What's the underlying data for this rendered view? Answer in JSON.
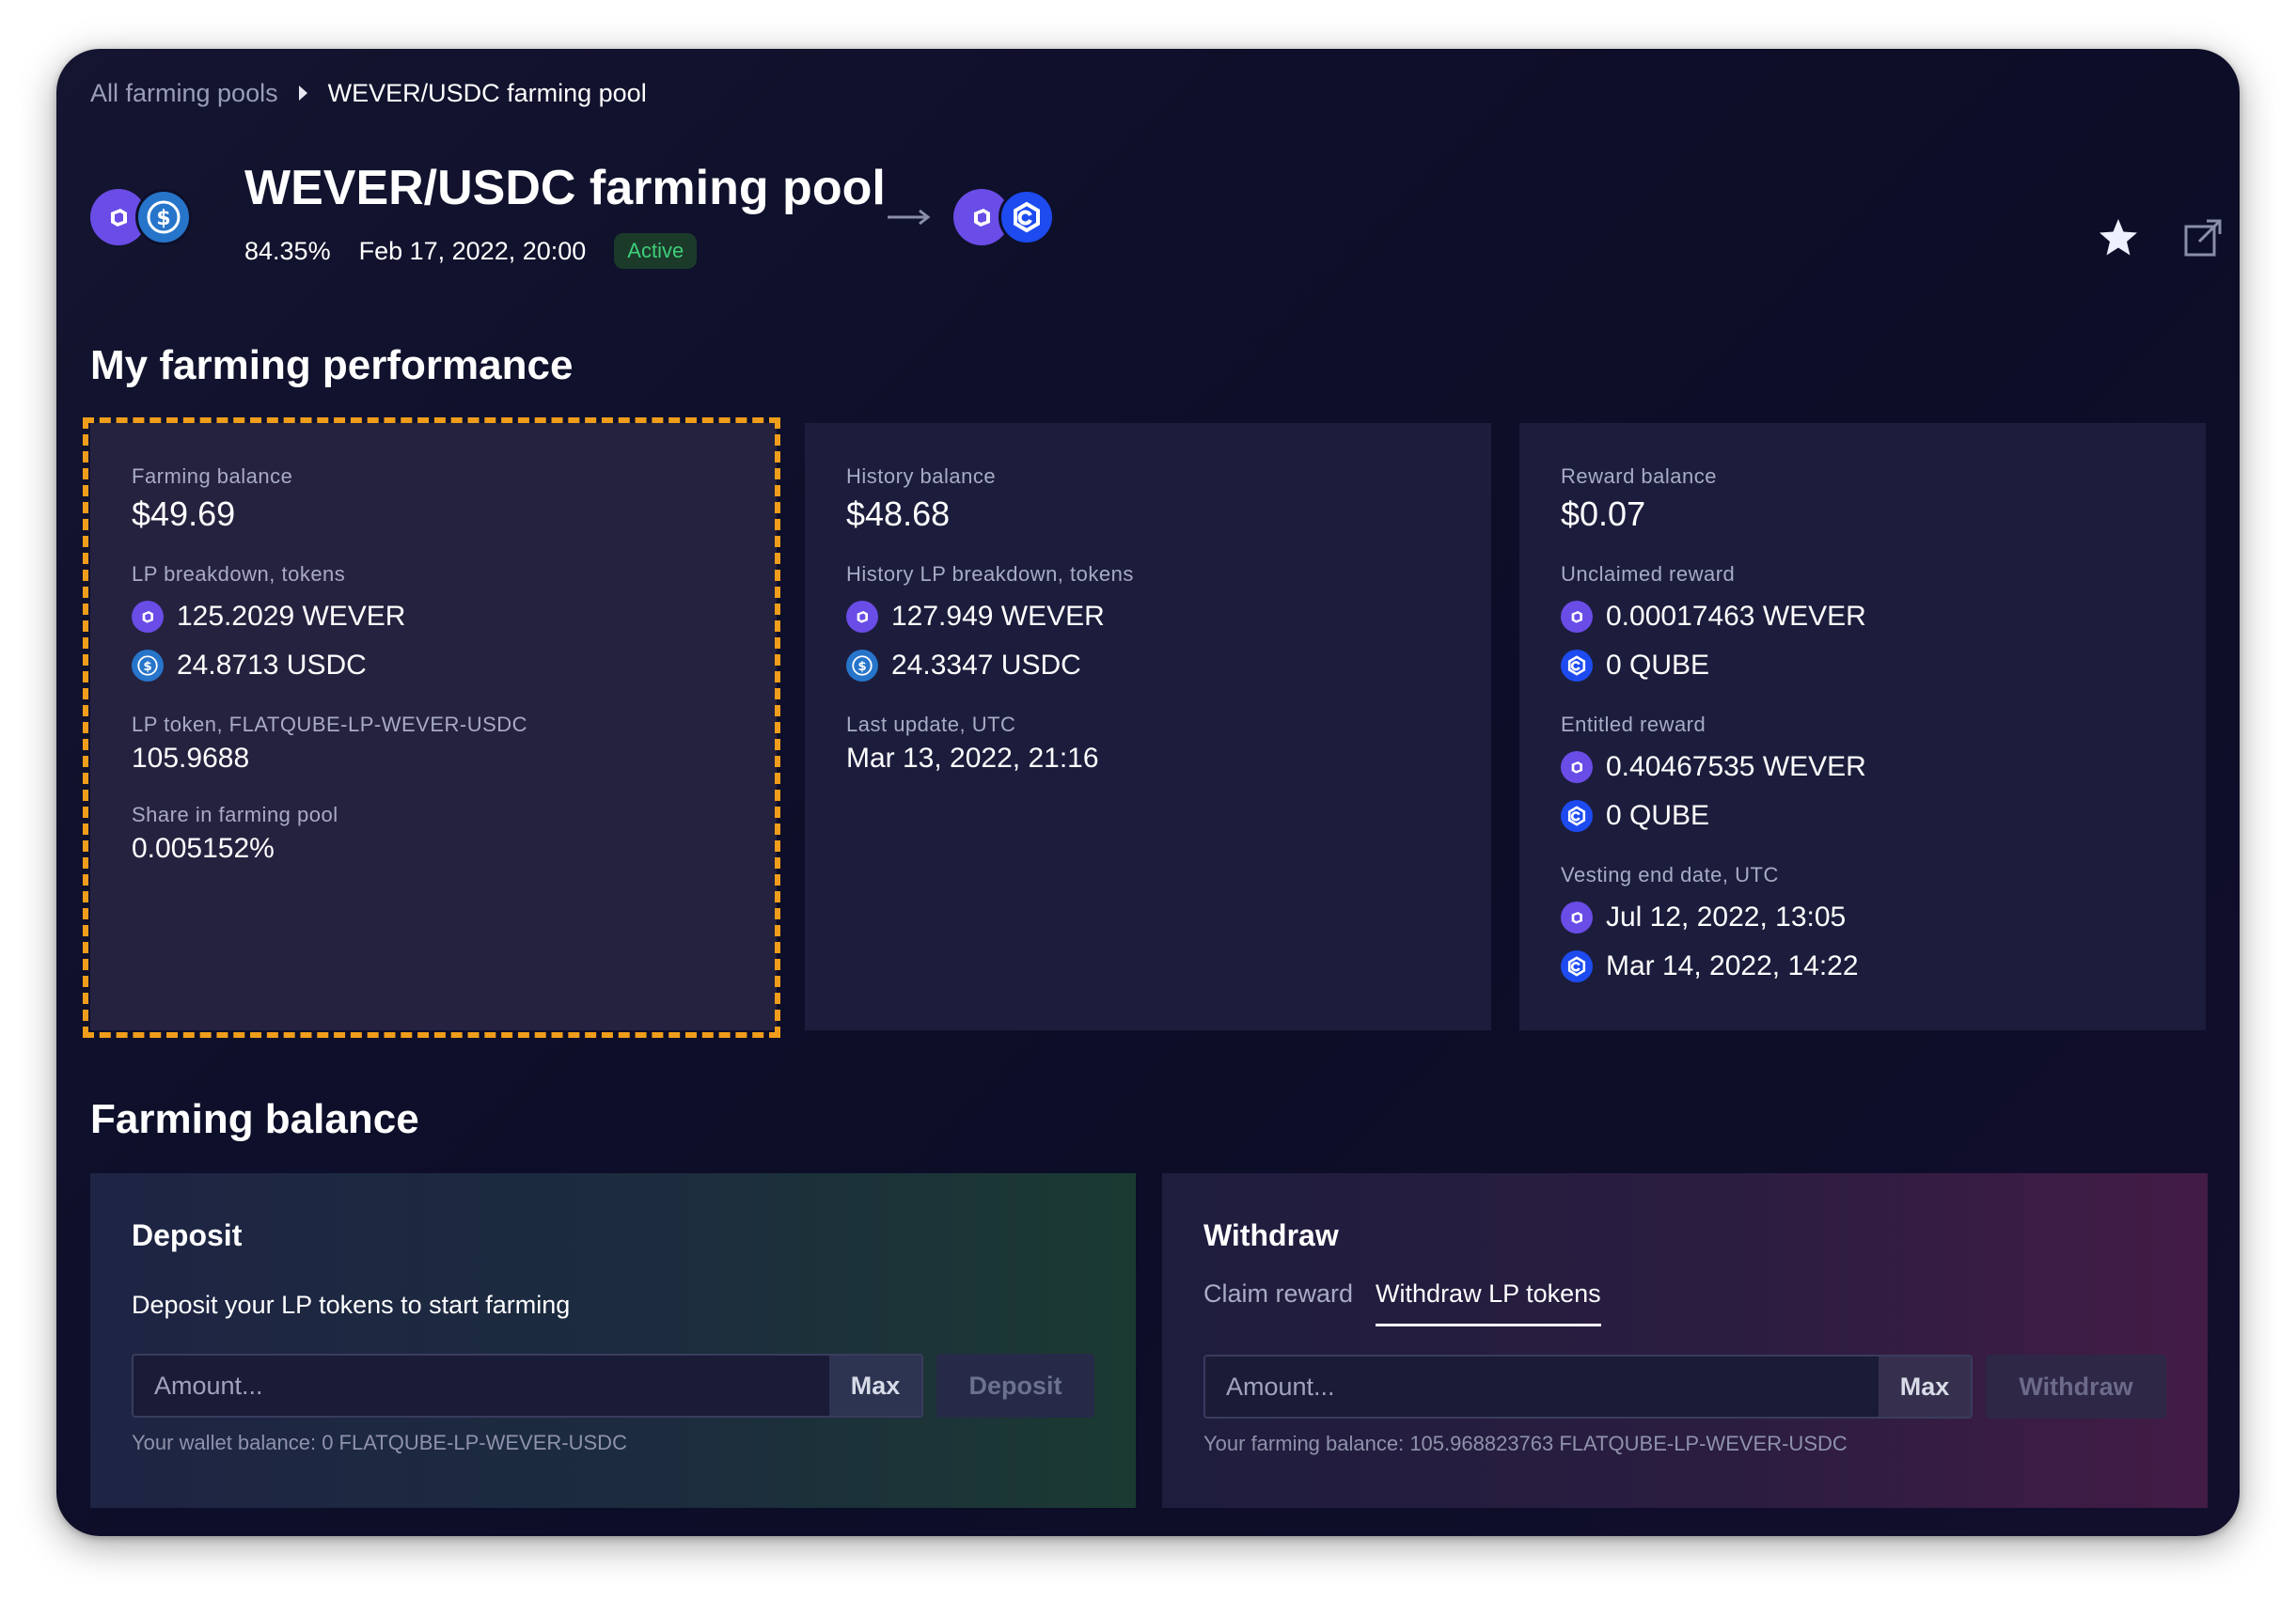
{
  "breadcrumb": {
    "parent": "All farming pools",
    "current": "WEVER/USDC farming pool"
  },
  "pool": {
    "title": "WEVER/USDC farming pool",
    "apr": "84.35%",
    "date": "Feb 17, 2022, 20:00",
    "status": "Active"
  },
  "icons": {
    "wever": "wever-token-icon",
    "usdc": "usdc-token-icon",
    "qube": "qube-token-icon",
    "star": "star-icon",
    "external": "external-link-icon",
    "arrow": "arrow-right-icon"
  },
  "colors": {
    "wever": "#6a4ce6",
    "usdc": "#2775ca",
    "qube": "#1d4bf0",
    "active": "#3ecf7a",
    "highlight": "#ef9d1a"
  },
  "performance": {
    "title": "My farming performance",
    "farming": {
      "balance_label": "Farming balance",
      "balance": "$49.69",
      "lp_label": "LP breakdown, tokens",
      "lp_wever": "125.2029 WEVER",
      "lp_usdc": "24.8713 USDC",
      "lp_token_label": "LP token, FLATQUBE-LP-WEVER-USDC",
      "lp_token": "105.9688",
      "share_label": "Share in farming pool",
      "share": "0.005152%"
    },
    "history": {
      "balance_label": "History balance",
      "balance": "$48.68",
      "lp_label": "History LP breakdown, tokens",
      "lp_wever": "127.949 WEVER",
      "lp_usdc": "24.3347 USDC",
      "update_label": "Last update, UTC",
      "update": "Mar 13, 2022, 21:16"
    },
    "reward": {
      "balance_label": "Reward balance",
      "balance": "$0.07",
      "unclaimed_label": "Unclaimed reward",
      "unclaimed_wever": "0.00017463 WEVER",
      "unclaimed_qube": "0 QUBE",
      "entitled_label": "Entitled reward",
      "entitled_wever": "0.40467535 WEVER",
      "entitled_qube": "0 QUBE",
      "vesting_label": "Vesting end date, UTC",
      "vesting_wever": "Jul 12, 2022, 13:05",
      "vesting_qube": "Mar 14, 2022, 14:22"
    }
  },
  "farming_balance": {
    "title": "Farming balance",
    "deposit": {
      "title": "Deposit",
      "desc": "Deposit your LP tokens to start farming",
      "placeholder": "Amount...",
      "max": "Max",
      "button": "Deposit",
      "hint": "Your wallet balance: 0 FLATQUBE-LP-WEVER-USDC"
    },
    "withdraw": {
      "title": "Withdraw",
      "tabs": [
        "Claim reward",
        "Withdraw LP tokens"
      ],
      "placeholder": "Amount...",
      "max": "Max",
      "button": "Withdraw",
      "hint": "Your farming balance: 105.968823763 FLATQUBE-LP-WEVER-USDC"
    }
  }
}
